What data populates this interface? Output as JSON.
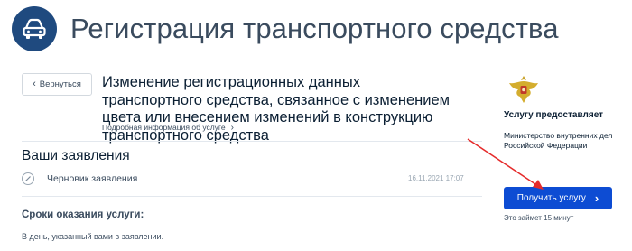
{
  "header": {
    "title": "Регистрация транспортного средства",
    "logo_icon": "car-icon"
  },
  "back_button": {
    "label": "Вернуться",
    "icon": "chevron-left-icon"
  },
  "service": {
    "title": "Изменение регистрационных данных транспортного средства, связанное с изменением цвета или внесением изменений в конструкцию транспортного средства",
    "details_link": "Подробная информация об услуге",
    "details_icon": "chevron-right-icon"
  },
  "applications": {
    "heading": "Ваши заявления",
    "items": [
      {
        "label": "Черновик заявления",
        "date": "16.11.2021 17:07",
        "icon": "draft-icon"
      }
    ]
  },
  "terms": {
    "heading": "Сроки оказания услуги:",
    "text": "В день, указанный вами в заявлении."
  },
  "provider": {
    "heading": "Услугу предоставляет",
    "name": "Министерство внутренних дел Российской Федерации",
    "emblem_icon": "emblem-icon"
  },
  "action": {
    "button_label": "Получить услугу",
    "duration": "Это займет 15 минут"
  },
  "colors": {
    "primary_button": "#0d4cd3",
    "logo_background": "#1f4a7f",
    "annotation_arrow": "#e52b2b",
    "text_dark": "#0b1f33"
  }
}
